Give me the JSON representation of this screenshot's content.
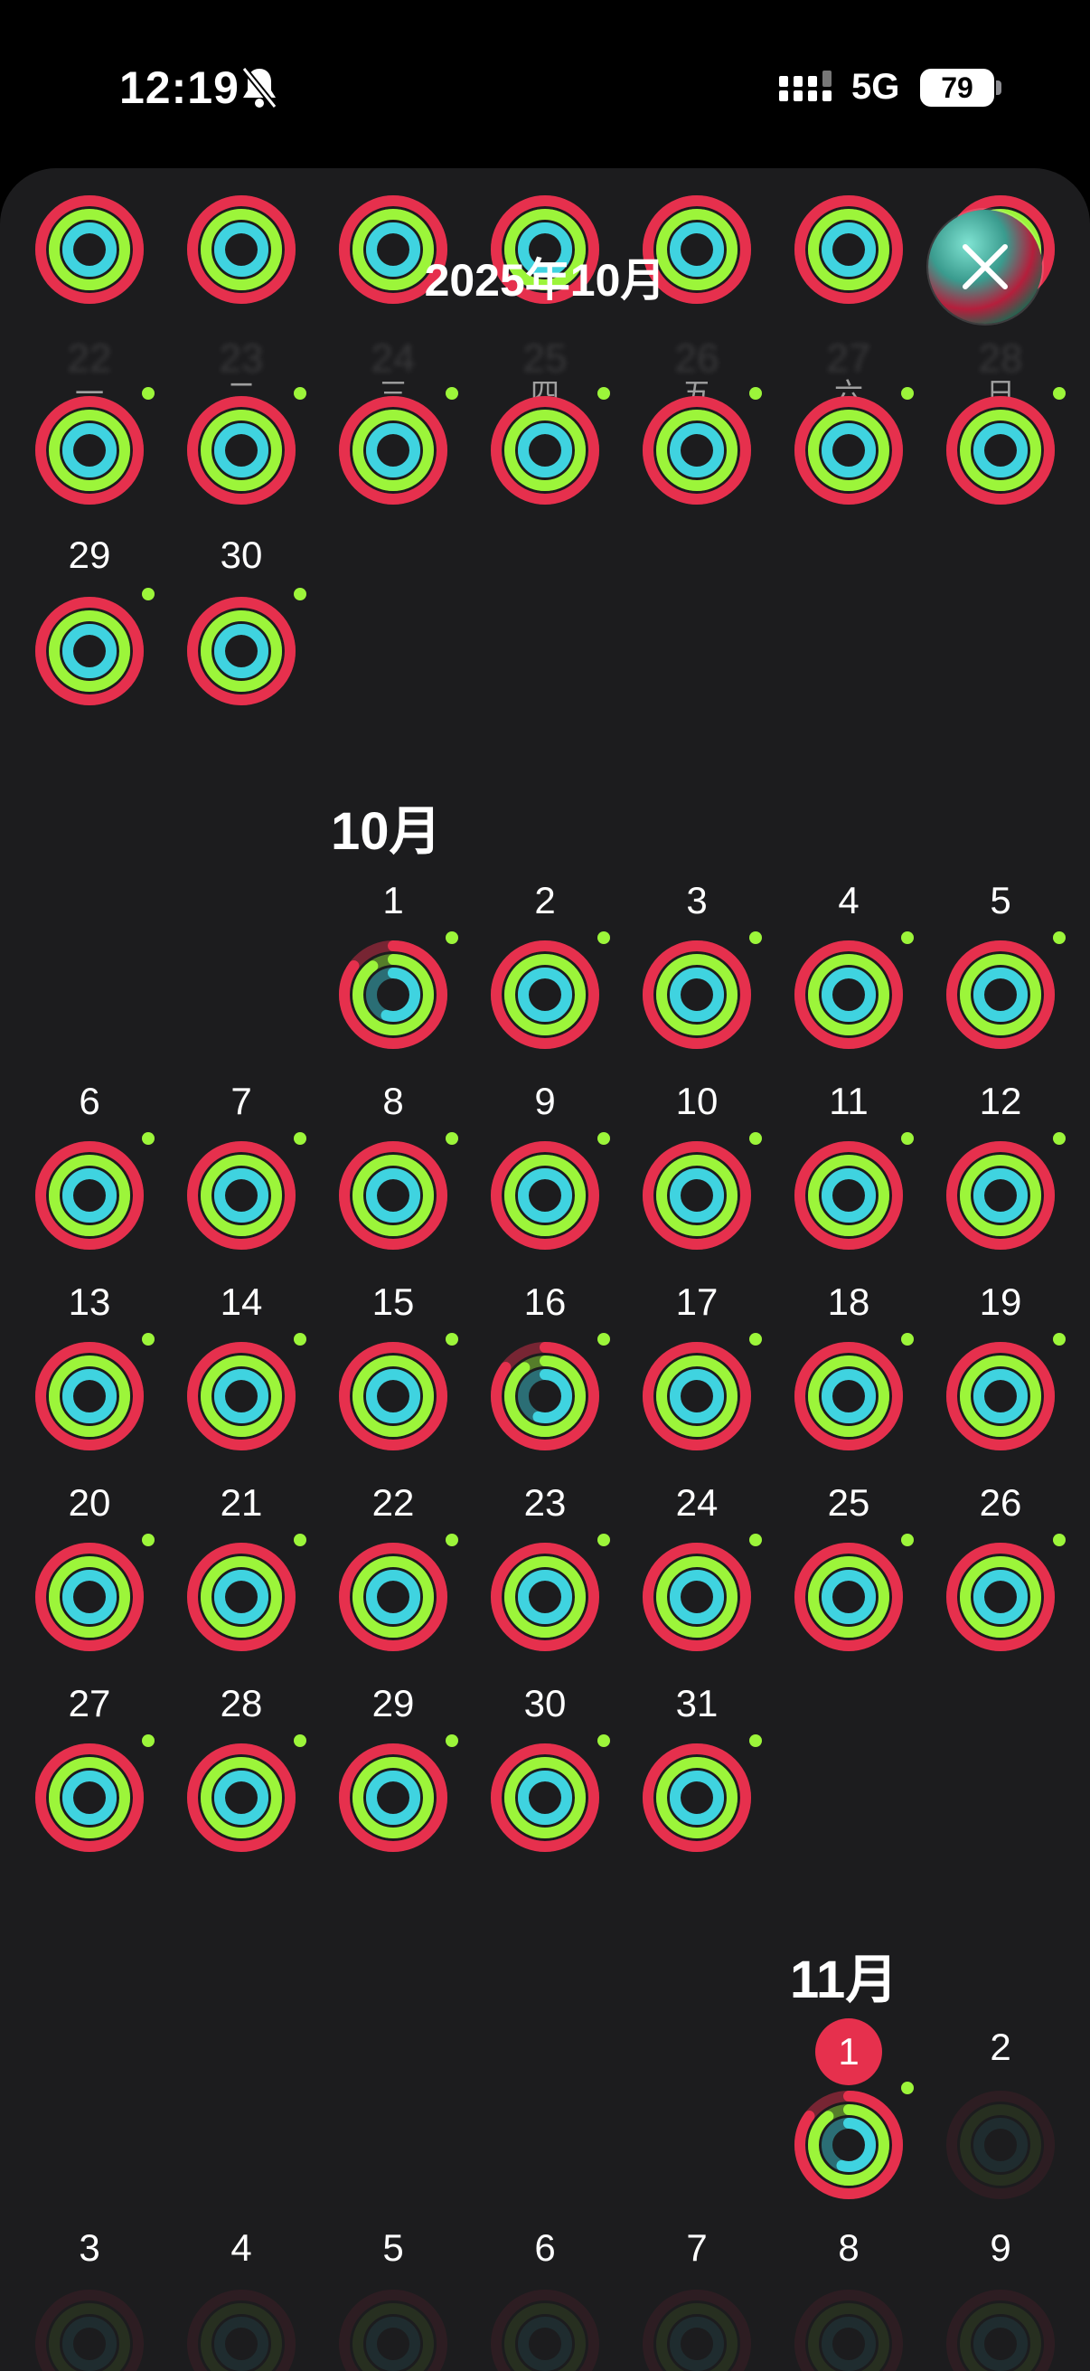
{
  "status_bar": {
    "time": "12:19",
    "network": "5G",
    "battery": "79",
    "bell_icon": "bell-slash-icon",
    "signal_icon": "signal-bars-icon"
  },
  "header": {
    "title": "2025年10月",
    "close_icon": "close-icon"
  },
  "weekdays": [
    "一",
    "二",
    "三",
    "四",
    "五",
    "六",
    "日"
  ],
  "partial_top_row": [
    "22",
    "23",
    "24",
    "25",
    "26",
    "27",
    "28"
  ],
  "september_tail": [
    "29",
    "30"
  ],
  "october": {
    "title": "10月",
    "days": [
      "1",
      "2",
      "3",
      "4",
      "5",
      "6",
      "7",
      "8",
      "9",
      "10",
      "11",
      "12",
      "13",
      "14",
      "15",
      "16",
      "17",
      "18",
      "19",
      "20",
      "21",
      "22",
      "23",
      "24",
      "25",
      "26",
      "27",
      "28",
      "29",
      "30",
      "31"
    ]
  },
  "november": {
    "title": "11月",
    "today": "1",
    "days": [
      "2",
      "3",
      "4",
      "5",
      "6",
      "7",
      "8",
      "9"
    ]
  },
  "colors": {
    "move": "#e6304d",
    "exercise": "#9cf53a",
    "stand": "#3fd3e0",
    "sheet": "#1c1c1e",
    "today_badge": "#e6304d"
  }
}
